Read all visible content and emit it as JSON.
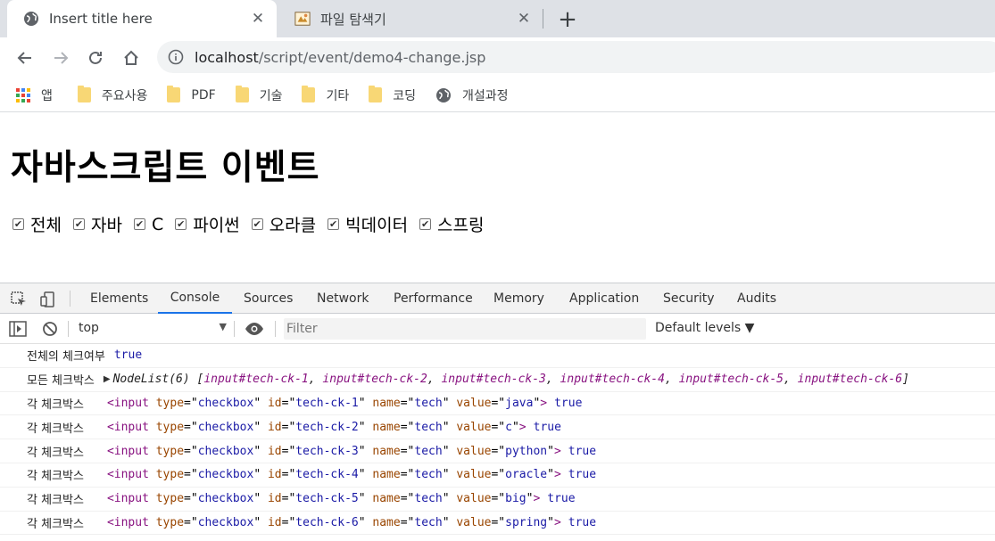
{
  "browser": {
    "tabs": [
      {
        "title": "Insert title here",
        "icon": "globe-icon",
        "active": true
      },
      {
        "title": "파일 탐색기",
        "icon": "file-explorer-icon",
        "active": false
      }
    ],
    "new_tab_label": "+",
    "close_label": "✕",
    "url": {
      "host": "localhost",
      "path": "/script/event/demo4-change.jsp"
    },
    "bookmarks": [
      {
        "label": "앱",
        "icon": "apps-grid-icon"
      },
      {
        "label": "주요사용",
        "icon": "folder-icon"
      },
      {
        "label": "PDF",
        "icon": "folder-icon"
      },
      {
        "label": "기술",
        "icon": "folder-icon"
      },
      {
        "label": "기타",
        "icon": "folder-icon"
      },
      {
        "label": "코딩",
        "icon": "folder-icon"
      },
      {
        "label": "개설과정",
        "icon": "globe-icon"
      }
    ]
  },
  "page": {
    "heading": "자바스크립트 이벤트",
    "checkboxes": [
      {
        "label": "전체",
        "checked": true
      },
      {
        "label": "자바",
        "checked": true
      },
      {
        "label": "C",
        "checked": true
      },
      {
        "label": "파이썬",
        "checked": true
      },
      {
        "label": "오라클",
        "checked": true
      },
      {
        "label": "빅데이터",
        "checked": true
      },
      {
        "label": "스프링",
        "checked": true
      }
    ]
  },
  "devtools": {
    "tabs": [
      "Elements",
      "Console",
      "Sources",
      "Network",
      "Performance",
      "Memory",
      "Application",
      "Security",
      "Audits"
    ],
    "active_tab": "Console",
    "context": "top",
    "filter_placeholder": "Filter",
    "levels": "Default levels ▼",
    "console": {
      "line1": {
        "label": "전체의 체크여부",
        "value": "true"
      },
      "line2": {
        "label": "모든 체크박스",
        "nodelist_prefix": "NodeList(6) [",
        "items": [
          "input#tech-ck-1",
          "input#tech-ck-2",
          "input#tech-ck-3",
          "input#tech-ck-4",
          "input#tech-ck-5",
          "input#tech-ck-6"
        ],
        "nodelist_suffix": "]"
      },
      "rows": [
        {
          "label": "각 체크박스",
          "id": "tech-ck-1",
          "name": "tech",
          "value": "java",
          "result": "true"
        },
        {
          "label": "각 체크박스",
          "id": "tech-ck-2",
          "name": "tech",
          "value": "c",
          "result": "true"
        },
        {
          "label": "각 체크박스",
          "id": "tech-ck-3",
          "name": "tech",
          "value": "python",
          "result": "true"
        },
        {
          "label": "각 체크박스",
          "id": "tech-ck-4",
          "name": "tech",
          "value": "oracle",
          "result": "true"
        },
        {
          "label": "각 체크박스",
          "id": "tech-ck-5",
          "name": "tech",
          "value": "big",
          "result": "true"
        },
        {
          "label": "각 체크박스",
          "id": "tech-ck-6",
          "name": "tech",
          "value": "spring",
          "result": "true"
        }
      ],
      "tag_open": "<input",
      "attr_type": "type",
      "attr_type_value": "checkbox",
      "attr_id": "id",
      "attr_name": "name",
      "attr_value": "value",
      "tag_close": ">"
    }
  }
}
